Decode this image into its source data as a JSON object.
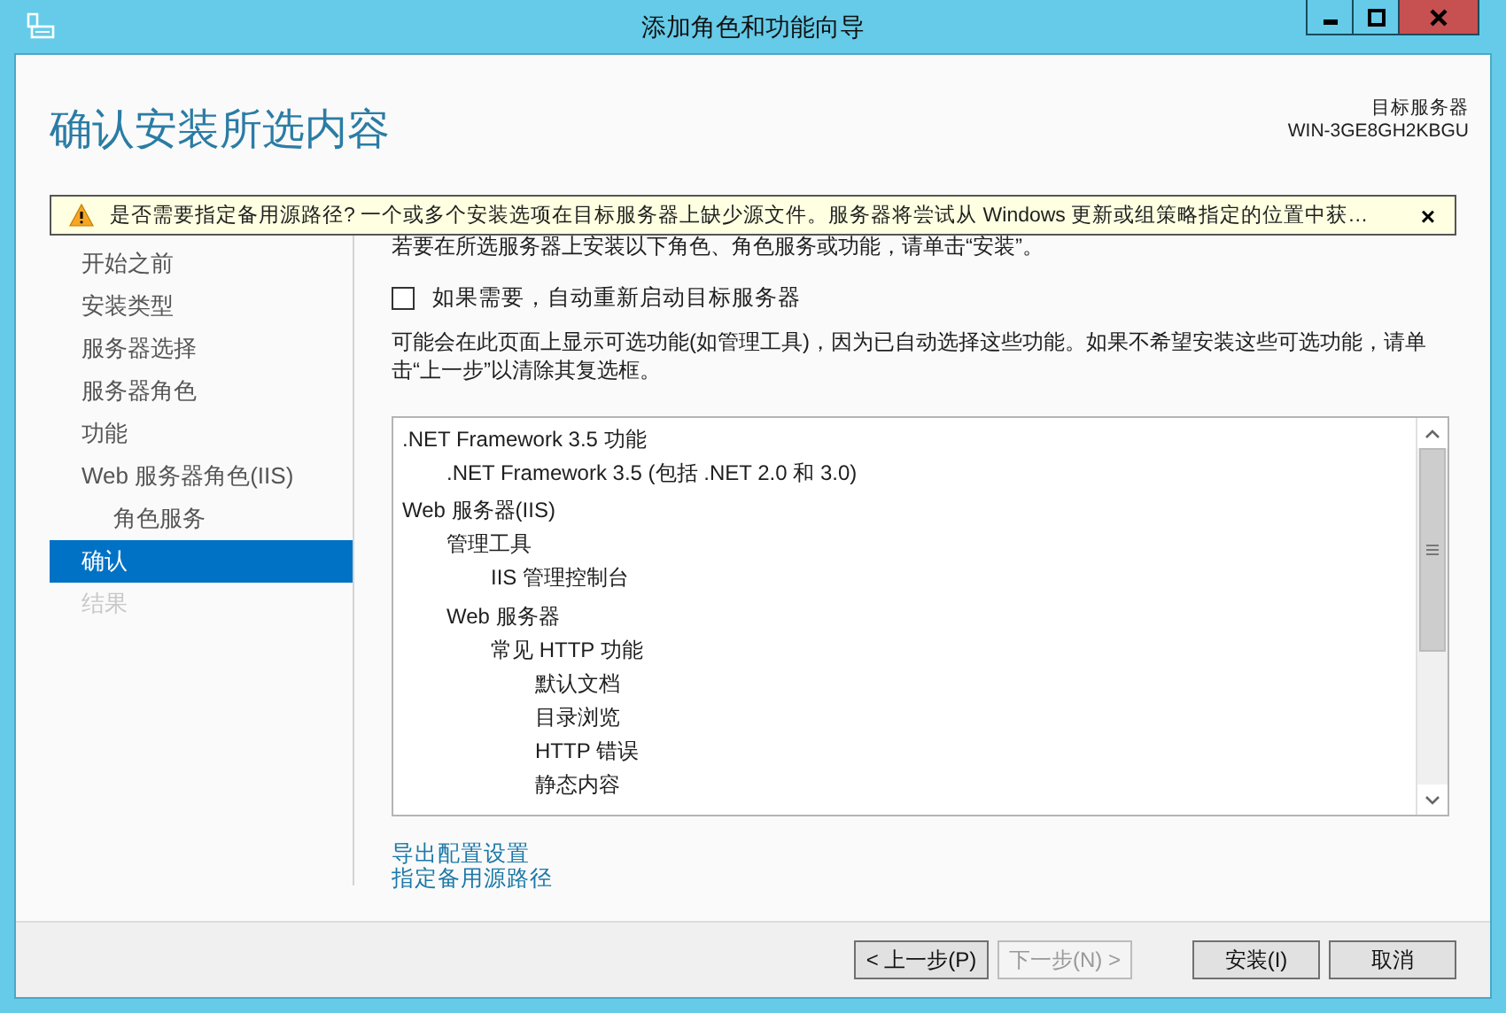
{
  "window": {
    "title": "添加角色和功能向导"
  },
  "header": {
    "title": "确认安装所选内容",
    "target_label": "目标服务器",
    "target_name": "WIN-3GE8GH2KBGU"
  },
  "warning": {
    "text": "是否需要指定备用源路径? 一个或多个安装选项在目标服务器上缺少源文件。服务器将尝试从 Windows 更新或组策略指定的位置中获…",
    "close": "×"
  },
  "sidebar": {
    "items": [
      {
        "label": "开始之前",
        "selected": false,
        "disabled": false
      },
      {
        "label": "安装类型",
        "selected": false,
        "disabled": false
      },
      {
        "label": "服务器选择",
        "selected": false,
        "disabled": false
      },
      {
        "label": "服务器角色",
        "selected": false,
        "disabled": false
      },
      {
        "label": "功能",
        "selected": false,
        "disabled": false
      },
      {
        "label": "Web 服务器角色(IIS)",
        "selected": false,
        "disabled": false,
        "children": [
          {
            "label": "角色服务",
            "selected": false,
            "disabled": false
          }
        ]
      },
      {
        "label": "确认",
        "selected": true,
        "disabled": false
      },
      {
        "label": "结果",
        "selected": false,
        "disabled": true
      }
    ]
  },
  "intro": "若要在所选服务器上安装以下角色、角色服务或功能，请单击“安装”。",
  "restart_option": {
    "label": "如果需要，自动重新启动目标服务器",
    "checked": false
  },
  "note": "可能会在此页面上显示可选功能(如管理工具)，因为已自动选择这些功能。如果不希望安装这些可选功能，请单击“上一步”以清除其复选框。",
  "tree": [
    {
      "label": ".NET Framework 3.5 功能",
      "children": [
        {
          "label": ".NET Framework 3.5 (包括 .NET 2.0 和 3.0)"
        }
      ]
    },
    {
      "label": "Web 服务器(IIS)",
      "children": [
        {
          "label": "管理工具",
          "children": [
            {
              "label": "IIS 管理控制台"
            }
          ]
        },
        {
          "label": "Web 服务器",
          "children": [
            {
              "label": "常见 HTTP 功能",
              "children": [
                {
                  "label": "默认文档"
                },
                {
                  "label": "目录浏览"
                },
                {
                  "label": "HTTP 错误"
                },
                {
                  "label": "静态内容"
                }
              ]
            }
          ]
        }
      ]
    }
  ],
  "links": [
    "导出配置设置",
    "指定备用源路径"
  ],
  "buttons": [
    {
      "label": "< 上一步(P)",
      "disabled": false
    },
    {
      "label": "下一步(N) >",
      "disabled": true
    },
    {
      "label": "安装(I)",
      "disabled": false
    },
    {
      "label": "取消",
      "disabled": false
    }
  ]
}
